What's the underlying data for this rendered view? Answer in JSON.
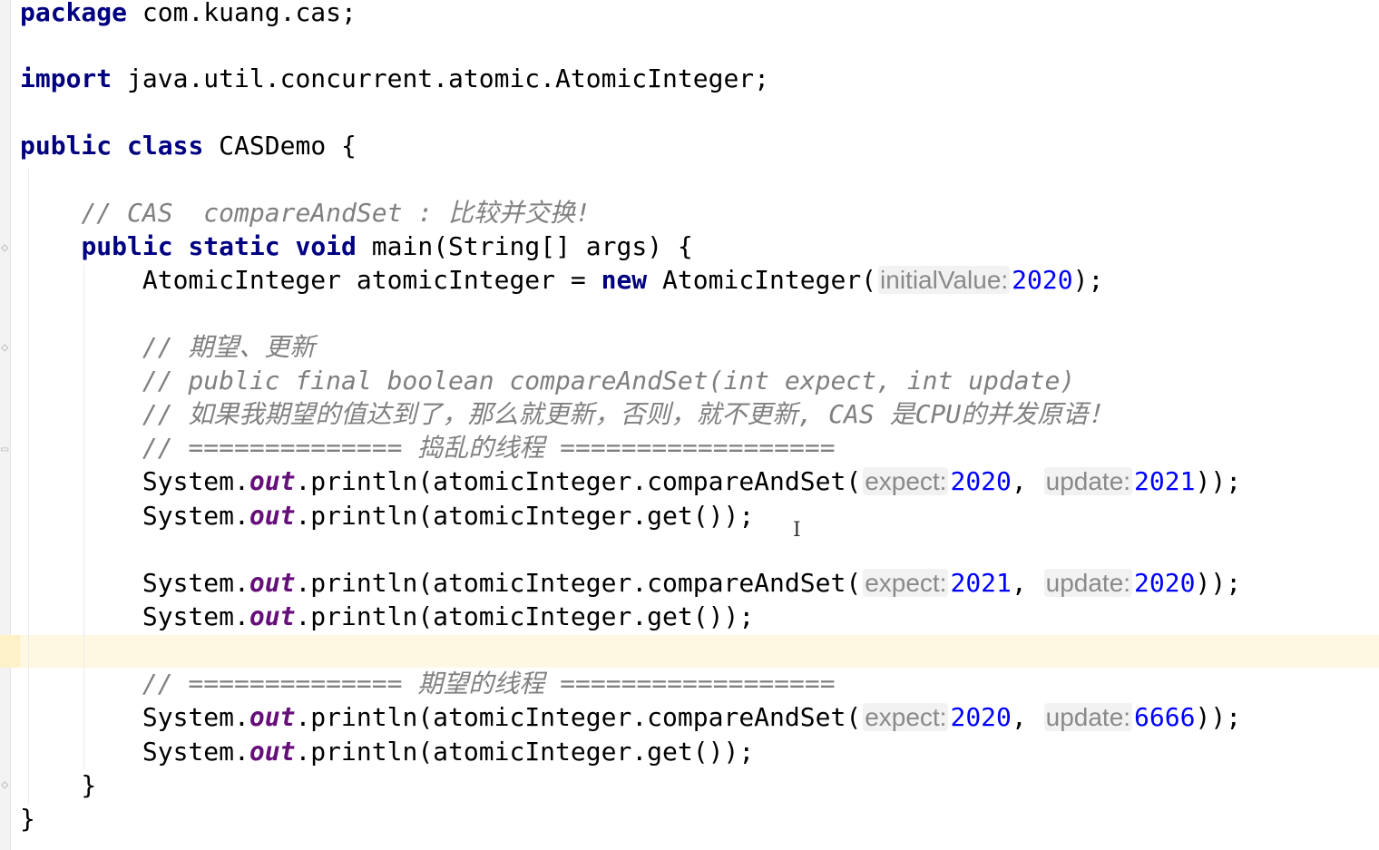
{
  "code": {
    "l1": {
      "kw": "package",
      "rest": " com.kuang.cas;"
    },
    "l2": {
      "kw": "import",
      "rest": " java.util.concurrent.atomic.AtomicInteger;"
    },
    "l3": {
      "kw1": "public",
      "kw2": "class",
      "rest": " CASDemo {"
    },
    "l4": {
      "indent": "    ",
      "comment": "// CAS  compareAndSet : 比较并交换!"
    },
    "l5": {
      "indent": "    ",
      "kw1": "public",
      "kw2": "static",
      "kw3": "void",
      "rest": " main(String[] args) {"
    },
    "l6": {
      "indent": "        ",
      "pre": "AtomicInteger atomicInteger = ",
      "kw": "new",
      "call": " AtomicInteger(",
      "hint": "initialValue:",
      "value": "2020",
      "post": ");"
    },
    "l7": {
      "indent": "        ",
      "comment": "// 期望、更新"
    },
    "l8": {
      "indent": "        ",
      "comment": "// public final boolean compareAndSet(int expect, int update)"
    },
    "l9": {
      "indent": "        ",
      "comment": "// 如果我期望的值达到了，那么就更新，否则，就不更新, CAS 是CPU的并发原语！"
    },
    "l10": {
      "indent": "        ",
      "comment": "// ============== 捣乱的线程 =================="
    },
    "l11": {
      "indent": "        ",
      "system": "System.",
      "out": "out",
      "call": ".println(atomicInteger.compareAndSet(",
      "hint1": "expect:",
      "value1": "2020",
      "sep": ", ",
      "hint2": "update:",
      "value2": "2021",
      "post": "));"
    },
    "l12": {
      "indent": "        ",
      "system": "System.",
      "out": "out",
      "call": ".println(atomicInteger.get());"
    },
    "l13": {
      "indent": "        ",
      "system": "System.",
      "out": "out",
      "call": ".println(atomicInteger.compareAndSet(",
      "hint1": "expect:",
      "value1": "2021",
      "sep": ", ",
      "hint2": "update:",
      "value2": "2020",
      "post": "));"
    },
    "l14": {
      "indent": "        ",
      "system": "System.",
      "out": "out",
      "call": ".println(atomicInteger.get());"
    },
    "l15": {
      "indent": "        ",
      "comment": "// ============== 期望的线程 =================="
    },
    "l16": {
      "indent": "        ",
      "system": "System.",
      "out": "out",
      "call": ".println(atomicInteger.compareAndSet(",
      "hint1": "expect:",
      "value1": "2020",
      "sep": ", ",
      "hint2": "update:",
      "value2": "6666",
      "post": "));"
    },
    "l17": {
      "indent": "        ",
      "system": "System.",
      "out": "out",
      "call": ".println(atomicInteger.get());"
    },
    "l18": {
      "text": "    }"
    },
    "l19": {
      "text": "}"
    }
  },
  "icons": {
    "fold": "fold-marker-icon",
    "cursor": "text-cursor-icon"
  },
  "colors": {
    "keyword": "#000080",
    "comment": "#808080",
    "static_field": "#660e7a",
    "number": "#0000ff",
    "caret_row": "#fef8e3"
  }
}
